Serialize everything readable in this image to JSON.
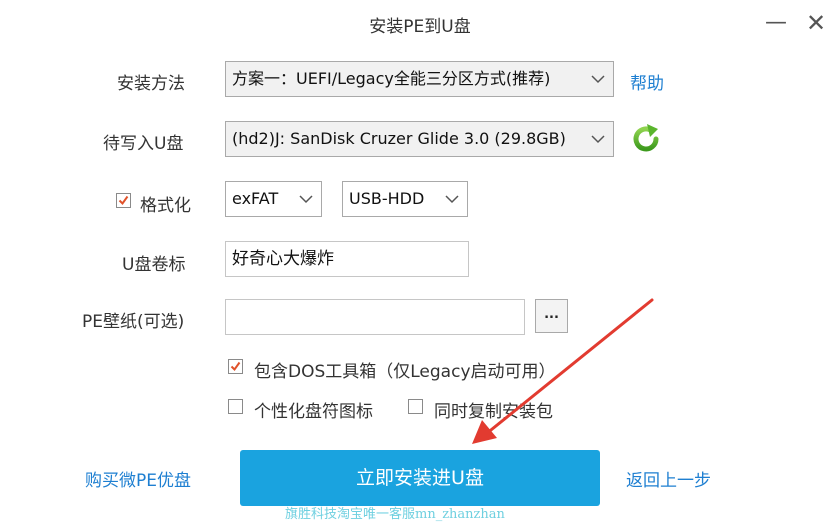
{
  "window": {
    "title": "安装PE到U盘",
    "minimize_symbol": "—",
    "close_symbol": "✕"
  },
  "install_method": {
    "label": "安装方法",
    "value": "方案一：UEFI/Legacy全能三分区方式(推荐)",
    "help_link": "帮助"
  },
  "target_disk": {
    "label": "待写入U盘",
    "value": "(hd2)J: SanDisk Cruzer Glide 3.0 (29.8GB)"
  },
  "format": {
    "label": "格式化",
    "checked": true,
    "filesystem": "exFAT",
    "mode": "USB-HDD"
  },
  "volume_label": {
    "label": "U盘卷标",
    "value": "好奇心大爆炸"
  },
  "wallpaper": {
    "label": "PE壁纸(可选)",
    "value": "",
    "browse_label": "..."
  },
  "options": {
    "dos_toolbox": "包含DOS工具箱（仅Legacy启动可用）",
    "custom_icon": "个性化盘符图标",
    "copy_installer": "同时复制安装包"
  },
  "footer": {
    "buy_link": "购买微PE优盘",
    "install_button": "立即安装进U盘",
    "back_link": "返回上一步"
  },
  "watermark": "旗胜科技淘宝唯一客服mn_zhanzhan",
  "colors": {
    "accent": "#1aa3df",
    "link": "#1e7fd1",
    "check": "#e0522a",
    "refresh": "#5ab52d",
    "arrow": "#e23b30"
  }
}
